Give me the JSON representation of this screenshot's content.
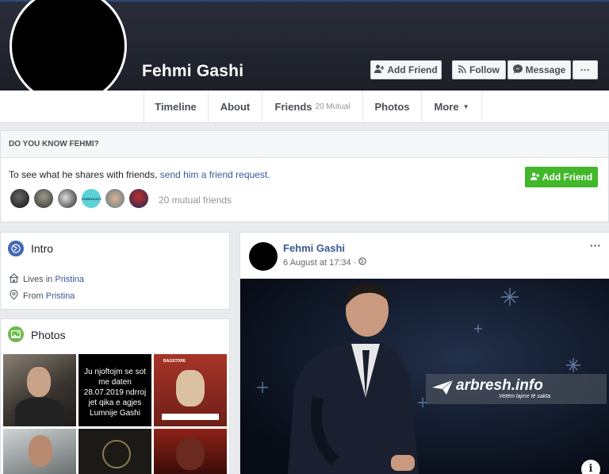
{
  "profile": {
    "name": "Fehmi Gashi",
    "buttons": {
      "add_friend": "Add Friend",
      "follow": "Follow",
      "message": "Message",
      "more": "···"
    }
  },
  "nav": {
    "tabs": [
      {
        "label": "Timeline"
      },
      {
        "label": "About"
      },
      {
        "label": "Friends",
        "sub": "20 Mutual"
      },
      {
        "label": "Photos"
      },
      {
        "label": "More"
      }
    ]
  },
  "know": {
    "heading": "DO YOU KNOW FEHMI?",
    "text": "To see what he shares with friends, ",
    "link": "send him a friend request.",
    "button": "Add Friend",
    "mutual_friends": "20 mutual friends",
    "mutual_avatar_text": "DORDOLECI"
  },
  "intro": {
    "title": "Intro",
    "lives_prefix": "Lives in ",
    "lives_place": "Pristina",
    "from_prefix": "From ",
    "from_place": "Pristina"
  },
  "photos": {
    "title": "Photos",
    "text_photo": "Ju njoftojm se sot me daten 28.07.2019 ndrroj jet qika e agjes Lumnije Gashi",
    "bagstore": "BAGSTORE"
  },
  "post": {
    "author": "Fehmi Gashi",
    "date": "6 August at 17:34 ·",
    "more": "···",
    "watermark_brand": "arbresh.info",
    "watermark_tagline": "Vetëm lajme të sakta",
    "info": "i"
  },
  "colors": {
    "cover": "#1c1f28",
    "link": "#385898",
    "green": "#42b72a",
    "page_bg": "#e9ebee"
  }
}
